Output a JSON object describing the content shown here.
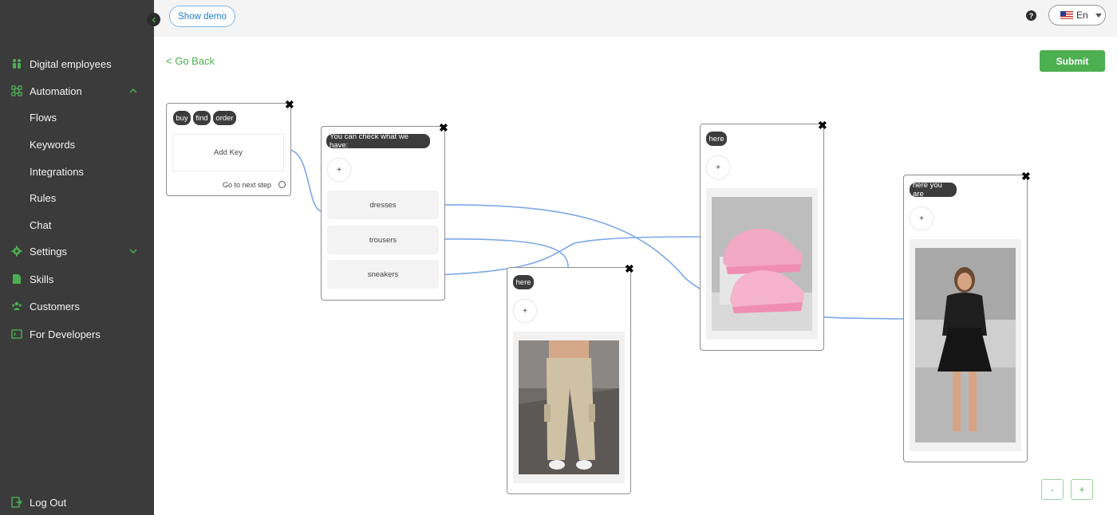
{
  "sidebar": {
    "items": [
      {
        "label": "Digital employees",
        "icon": "digital-employees-icon"
      },
      {
        "label": "Automation",
        "icon": "automation-icon"
      },
      {
        "label": "Flows"
      },
      {
        "label": "Keywords"
      },
      {
        "label": "Integrations"
      },
      {
        "label": "Rules"
      },
      {
        "label": "Chat"
      },
      {
        "label": "Settings",
        "icon": "gear-icon"
      },
      {
        "label": "Skills",
        "icon": "document-icon"
      },
      {
        "label": "Customers",
        "icon": "users-icon"
      },
      {
        "label": "For Developers",
        "icon": "terminal-icon"
      }
    ],
    "logout_label": "Log Out"
  },
  "topbar": {
    "show_demo_label": "Show demo",
    "language": "En"
  },
  "header": {
    "go_back_label": "< Go Back",
    "submit_label": "Submit"
  },
  "nodes": {
    "start": {
      "tags": [
        "buy",
        "find",
        "order"
      ],
      "add_key_label": "Add Key",
      "next_step_label": "Go to next step"
    },
    "menu": {
      "message": "You can check what we have:",
      "plus": "+",
      "options": [
        "dresses",
        "trousers",
        "sneakers"
      ]
    },
    "trousers": {
      "message": "here",
      "plus": "+"
    },
    "sneakers": {
      "message": "here",
      "plus": "+"
    },
    "dress": {
      "message": "here you are",
      "plus": "+"
    }
  },
  "zoom": {
    "out_label": "-",
    "in_label": "+"
  },
  "colors": {
    "accent": "#4caf50",
    "sidebar_bg": "#3b3b3b",
    "edge": "#7ea8e6",
    "demo_blue": "#1f7dd4"
  }
}
